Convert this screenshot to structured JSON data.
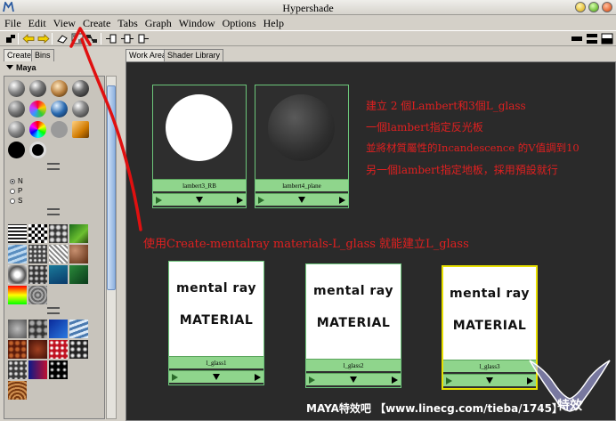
{
  "window": {
    "title": "Hypershade"
  },
  "menu": [
    "File",
    "Edit",
    "View",
    "Create",
    "Tabs",
    "Graph",
    "Window",
    "Options",
    "Help"
  ],
  "left_panel": {
    "tabs": [
      "Create",
      "Bins"
    ],
    "section": "Maya",
    "radio_options": [
      "N",
      "P",
      "S"
    ],
    "selected_radio": "N"
  },
  "right_panel": {
    "tabs": [
      "Work Area",
      "Shader Library"
    ]
  },
  "nodes": [
    {
      "label": "lambert3_RB"
    },
    {
      "label": "lambert4_plane"
    },
    {
      "label": "l_glass1",
      "line1": "mental ray",
      "line2": "MATERIAL"
    },
    {
      "label": "l_glass2",
      "line1": "mental ray",
      "line2": "MATERIAL"
    },
    {
      "label": "l_glass3",
      "line1": "mental ray",
      "line2": "MATERIAL"
    }
  ],
  "annotations": [
    "建立 2 個Lambert和3個L_glass",
    "一個lambert指定反光板",
    "並將材質屬性的Incandescence 的V值調到10",
    "另一個lambert指定地板，採用預設就行",
    "使用Create-mentalray materials-L_glass  就能建立L_glass"
  ],
  "credit": "MAYA特效吧 【www.linecg.com/tieba/1745】",
  "watermark_text": "V 特效",
  "colors": {
    "node_header": "#8fd58c",
    "node_border": "#6cc67a",
    "annotation_red": "#e02020",
    "canvas": "#2a2a2a"
  }
}
